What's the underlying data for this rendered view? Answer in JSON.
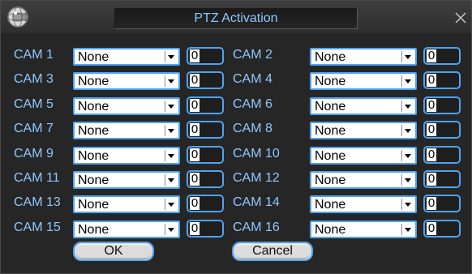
{
  "window": {
    "title": "PTZ Activation",
    "logo_icon": "camera-globe-icon",
    "close_icon": "close-icon"
  },
  "colors": {
    "label": "#8fc7ff",
    "accent": "#4fa3f0",
    "background": "#262626"
  },
  "cameras": [
    {
      "label": "CAM 1",
      "protocol": "None",
      "number": "0"
    },
    {
      "label": "CAM 2",
      "protocol": "None",
      "number": "0"
    },
    {
      "label": "CAM 3",
      "protocol": "None",
      "number": "0"
    },
    {
      "label": "CAM 4",
      "protocol": "None",
      "number": "0"
    },
    {
      "label": "CAM 5",
      "protocol": "None",
      "number": "0"
    },
    {
      "label": "CAM 6",
      "protocol": "None",
      "number": "0"
    },
    {
      "label": "CAM 7",
      "protocol": "None",
      "number": "0"
    },
    {
      "label": "CAM 8",
      "protocol": "None",
      "number": "0"
    },
    {
      "label": "CAM 9",
      "protocol": "None",
      "number": "0"
    },
    {
      "label": "CAM 10",
      "protocol": "None",
      "number": "0"
    },
    {
      "label": "CAM 11",
      "protocol": "None",
      "number": "0"
    },
    {
      "label": "CAM 12",
      "protocol": "None",
      "number": "0"
    },
    {
      "label": "CAM 13",
      "protocol": "None",
      "number": "0"
    },
    {
      "label": "CAM 14",
      "protocol": "None",
      "number": "0"
    },
    {
      "label": "CAM 15",
      "protocol": "None",
      "number": "0"
    },
    {
      "label": "CAM 16",
      "protocol": "None",
      "number": "0"
    }
  ],
  "buttons": {
    "ok": "OK",
    "cancel": "Cancel"
  }
}
